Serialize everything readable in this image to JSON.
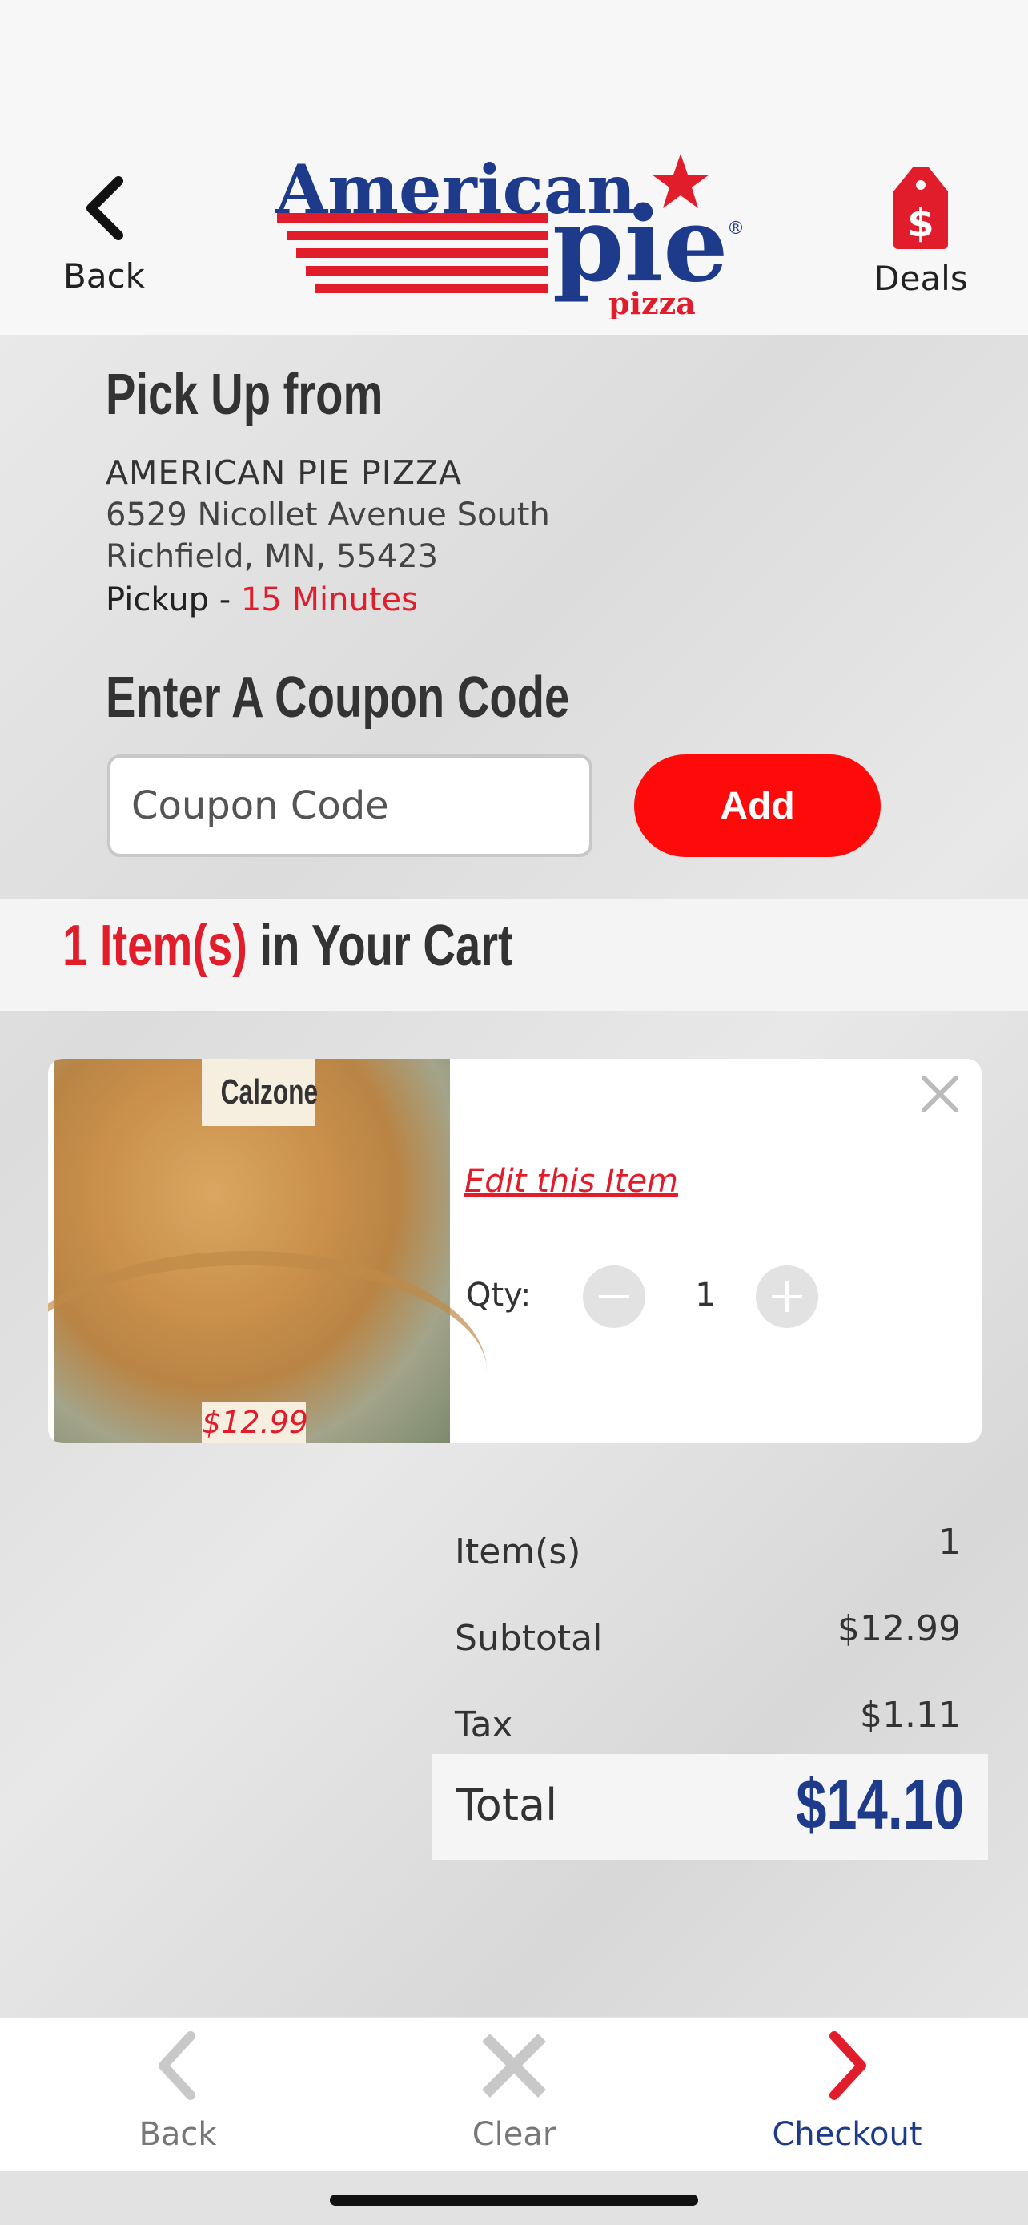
{
  "header": {
    "back_label": "Back",
    "deals_label": "Deals",
    "logo": {
      "line1": "American",
      "line2": "pie",
      "line3": "pizza",
      "registered": "®"
    }
  },
  "pickup": {
    "title": "Pick Up from",
    "store_name": "AMERICAN PIE PIZZA",
    "address_line1": "6529 Nicollet Avenue South",
    "address_line2": "Richfield, MN, 55423",
    "pickup_label": "Pickup - ",
    "pickup_time": "15 Minutes"
  },
  "coupon": {
    "title": "Enter A Coupon Code",
    "placeholder": "Coupon Code",
    "value": "",
    "add_label": "Add"
  },
  "cart": {
    "count_label": "1 Item(s)",
    "suffix": " in Your Cart",
    "items": [
      {
        "name": "Calzone",
        "price": "$12.99",
        "edit_label": "Edit this Item",
        "qty_label": "Qty:",
        "qty": "1"
      }
    ]
  },
  "summary": {
    "items_label": "Item(s)",
    "items_value": "1",
    "subtotal_label": "Subtotal",
    "subtotal_value": "$12.99",
    "tax_label": "Tax",
    "tax_value": "$1.11",
    "total_label": "Total",
    "total_value": "$14.10"
  },
  "bottom_nav": {
    "back_label": "Back",
    "clear_label": "Clear",
    "checkout_label": "Checkout"
  },
  "colors": {
    "brand_red": "#e21d2b",
    "brand_blue": "#1e3a8a",
    "add_button": "#ff0a0a"
  }
}
